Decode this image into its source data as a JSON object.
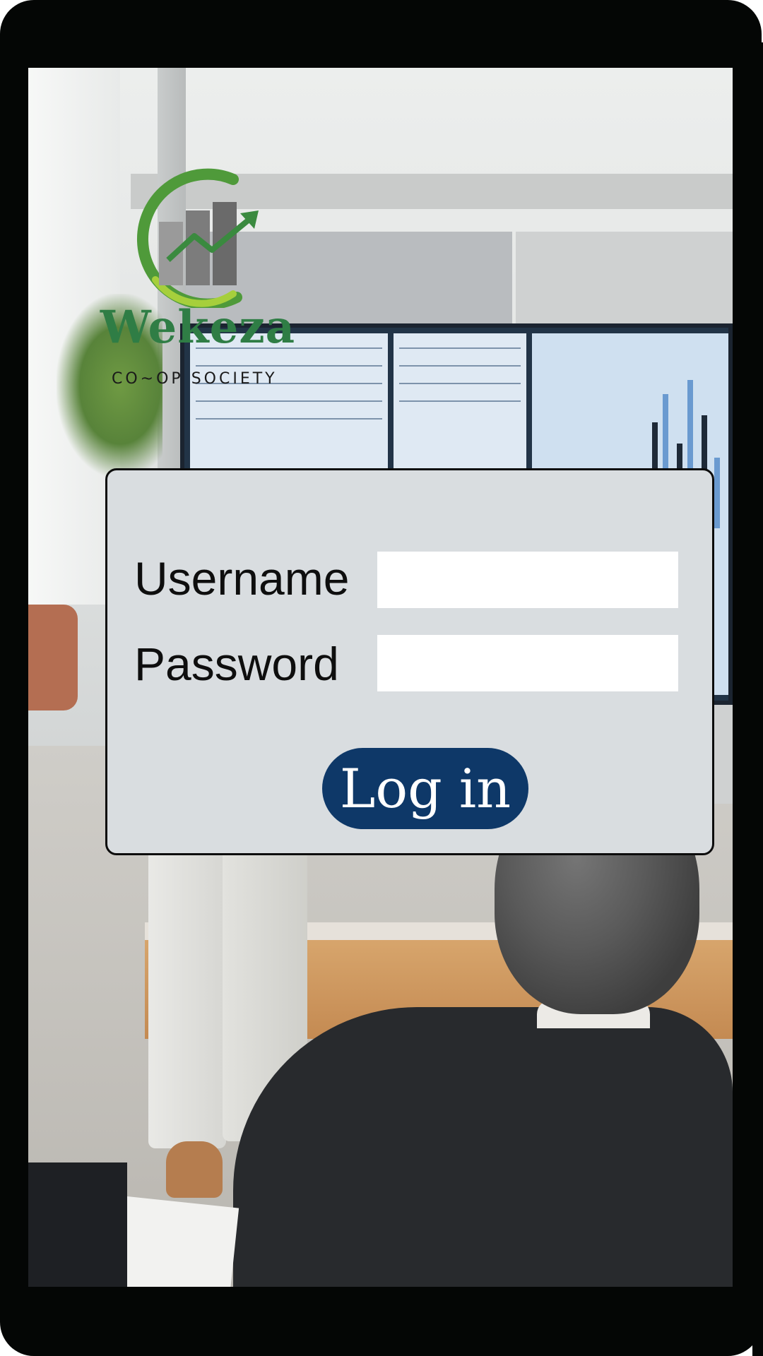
{
  "brand": {
    "name": "Wekeza",
    "subtitle": "CO~OP SOCIETY",
    "logo_icon": "growth-chart-logo",
    "colors": {
      "green": "#2f7d45",
      "lime": "#9fc93c",
      "gray": "#8a8a8a"
    }
  },
  "login": {
    "username_label": "Username",
    "password_label": "Password",
    "username_value": "",
    "password_value": "",
    "submit_label": "Log in",
    "colors": {
      "card": "#d9dde0",
      "button": "#0e3868"
    }
  }
}
